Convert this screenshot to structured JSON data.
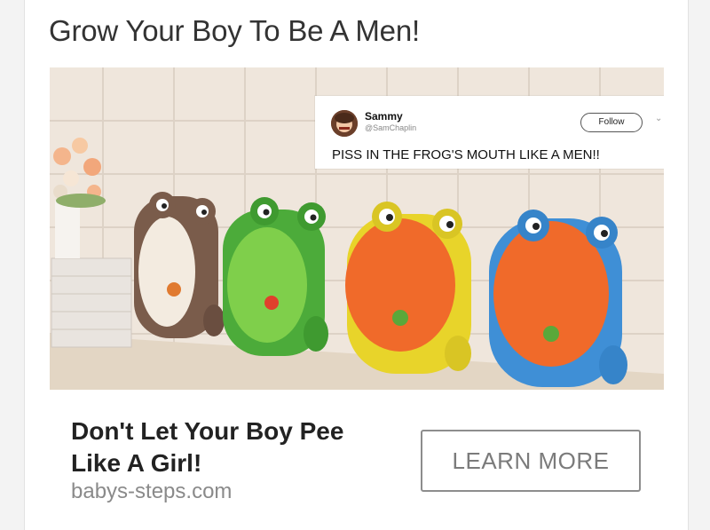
{
  "ad": {
    "headline": "Grow Your Boy To Be A Men!",
    "cta_title": "Don't Let Your Boy Pee Like A Girl!",
    "domain": "babys-steps.com",
    "cta_button": "LEARN MORE"
  },
  "tweet": {
    "name": "Sammy",
    "handle": "@SamChaplin",
    "follow_label": "Follow",
    "chevron": "⌄",
    "text": "PISS IN THE FROG'S MOUTH LIKE A MEN!!"
  },
  "image": {
    "subject": "frog-shaped-potty-urinals",
    "colors": [
      "#7a5c4b",
      "#4cab3a",
      "#f06a2a",
      "#3f8fd6"
    ]
  }
}
